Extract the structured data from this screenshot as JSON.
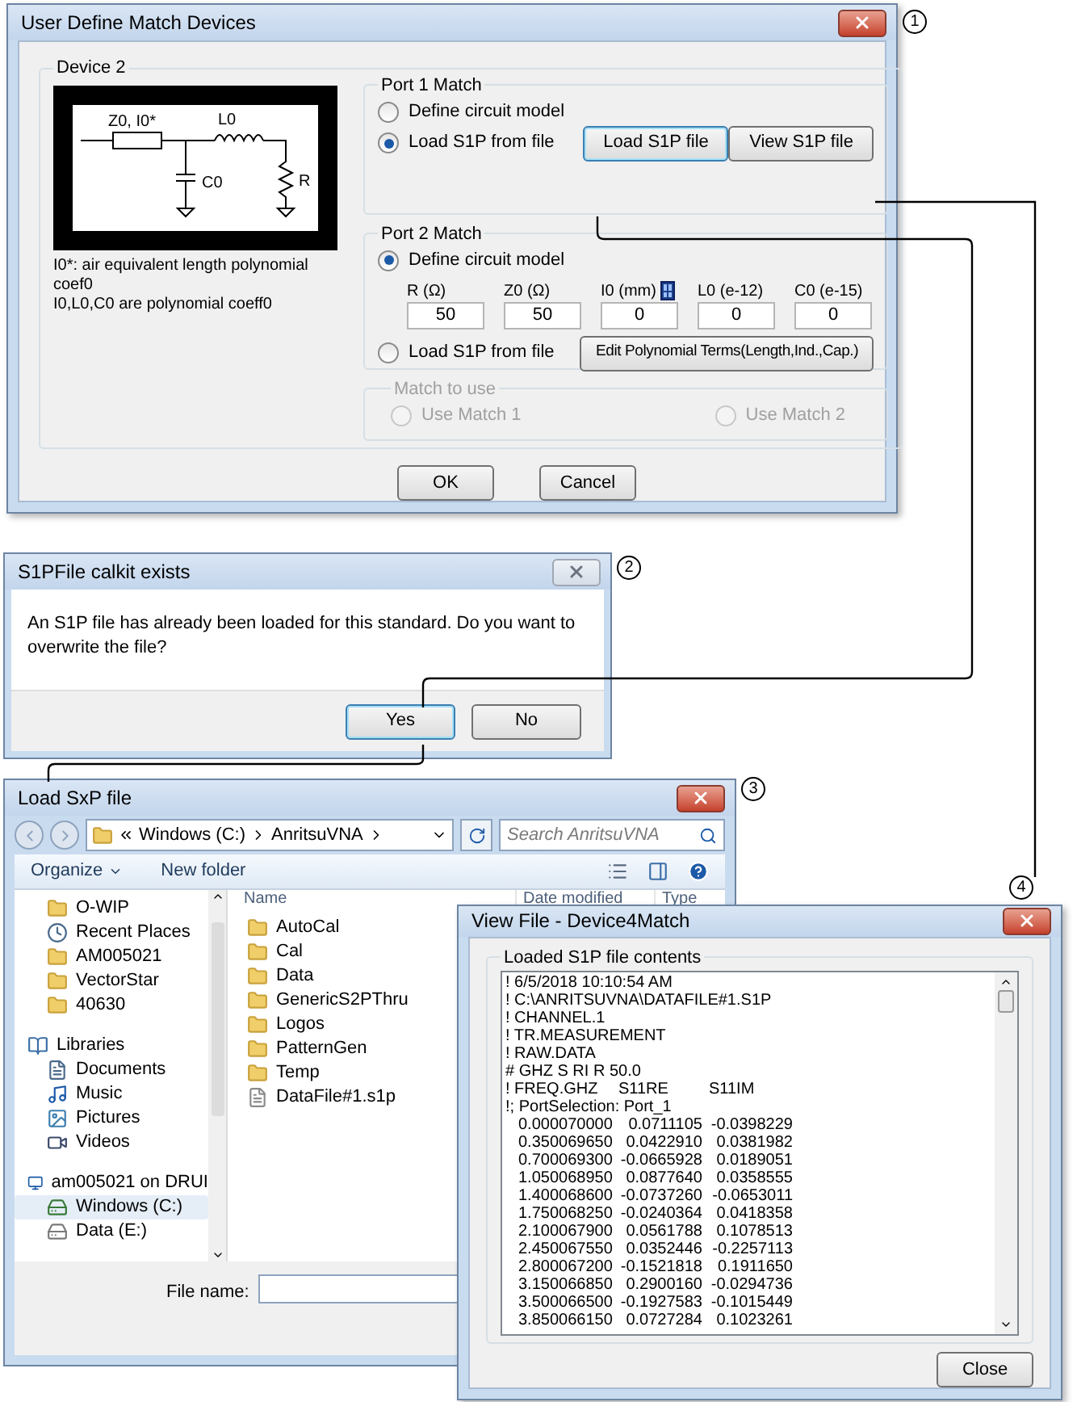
{
  "callouts": [
    "1",
    "2",
    "3",
    "4"
  ],
  "match_dialog": {
    "title": "User Define Match Devices",
    "group": "Device 2",
    "circuit_labels": [
      "Z0, I0*",
      "L0",
      "C0",
      "R"
    ],
    "notes": [
      "I0*: air equivalent length polynomial coef0",
      "I0,L0,C0 are polynomial coeff0"
    ],
    "port1": {
      "title": "Port 1 Match",
      "options": [
        {
          "label": "Define circuit model",
          "selected": false
        },
        {
          "label": "Load S1P from file",
          "selected": true
        }
      ],
      "load_button": "Load S1P file",
      "view_button": "View S1P file"
    },
    "port2": {
      "title": "Port 2 Match",
      "options": [
        {
          "label": "Define circuit model",
          "selected": true
        },
        {
          "label": "Load S1P from file",
          "selected": false
        }
      ],
      "fields": [
        {
          "label": "R (Ω)",
          "value": "50"
        },
        {
          "label": "Z0 (Ω)",
          "value": "50"
        },
        {
          "label": "I0 (mm)",
          "value": "0",
          "calculator": true
        },
        {
          "label": "L0 (e-12)",
          "value": "0"
        },
        {
          "label": "C0 (e-15)",
          "value": "0"
        }
      ],
      "edit_button": "Edit Polynomial Terms(Length,Ind.,Cap.)"
    },
    "match_to_use": {
      "title": "Match to use",
      "disabled": true,
      "options": [
        {
          "label": "Use Match 1",
          "selected": false
        },
        {
          "label": "Use Match 2",
          "selected": false
        }
      ]
    },
    "buttons": [
      "OK",
      "Cancel"
    ]
  },
  "overwrite_dialog": {
    "title": "S1PFile calkit exists",
    "message": "An S1P file has already been loaded for this standard. Do you want to overwrite the file?",
    "buttons": [
      {
        "label": "Yes",
        "default": true
      },
      {
        "label": "No",
        "default": false
      }
    ]
  },
  "file_dialog": {
    "title": "Load SxP file",
    "path": [
      "Windows (C:)",
      "AnritsuVNA"
    ],
    "search_placeholder": "Search AnritsuVNA",
    "toolbar": [
      "Organize",
      "New folder"
    ],
    "nav": [
      {
        "label": "O-WIP",
        "kind": "folder",
        "selected": false
      },
      {
        "label": "Recent Places",
        "kind": "recent",
        "selected": false
      },
      {
        "label": "AM005021",
        "kind": "folder",
        "selected": false
      },
      {
        "label": "VectorStar",
        "kind": "folder",
        "selected": false
      },
      {
        "label": "40630",
        "kind": "folder",
        "selected": false
      },
      {
        "label": "Libraries",
        "kind": "library",
        "selected": false,
        "children": [
          {
            "label": "Documents",
            "kind": "documents",
            "selected": false
          },
          {
            "label": "Music",
            "kind": "music",
            "selected": false
          },
          {
            "label": "Pictures",
            "kind": "pictures",
            "selected": false
          },
          {
            "label": "Videos",
            "kind": "videos",
            "selected": false
          }
        ]
      },
      {
        "label": "am005021 on DRUI",
        "kind": "computer",
        "selected": false,
        "children": [
          {
            "label": "Windows (C:)",
            "kind": "system_drive",
            "selected": true
          },
          {
            "label": "Data (E:)",
            "kind": "drive",
            "selected": false
          }
        ]
      }
    ],
    "columns": [
      "Name",
      "Date modified",
      "Type"
    ],
    "files": [
      {
        "name": "AutoCal",
        "kind": "folder"
      },
      {
        "name": "Cal",
        "kind": "folder"
      },
      {
        "name": "Data",
        "kind": "folder"
      },
      {
        "name": "GenericS2PThru",
        "kind": "folder"
      },
      {
        "name": "Logos",
        "kind": "folder"
      },
      {
        "name": "PatternGen",
        "kind": "folder"
      },
      {
        "name": "Temp",
        "kind": "folder"
      },
      {
        "name": "DataFile#1.s1p",
        "kind": "file"
      }
    ],
    "file_name_label": "File name:"
  },
  "view_file": {
    "title": "View File - Device4Match",
    "group": "Loaded S1P file contents",
    "header_lines": [
      "! 6/5/2018 10:10:54 AM",
      "! C:\\ANRITSUVNA\\DATAFILE#1.S1P",
      "! CHANNEL.1",
      "! TR.MEASUREMENT",
      "! RAW.DATA",
      "# GHZ S RI R 50.0"
    ],
    "column_line": [
      "! FREQ.GHZ",
      "S11RE",
      "S11IM"
    ],
    "port_line": "!; PortSelection: Port_1",
    "rows": [
      [
        "0.000070000",
        "0.0711105",
        "-0.0398229"
      ],
      [
        "0.350069650",
        "0.0422910",
        "0.0381982"
      ],
      [
        "0.700069300",
        "-0.0665928",
        "0.0189051"
      ],
      [
        "1.050068950",
        "0.0877640",
        "0.0358555"
      ],
      [
        "1.400068600",
        "-0.0737260",
        "-0.0653011"
      ],
      [
        "1.750068250",
        "-0.0240364",
        "0.0418358"
      ],
      [
        "2.100067900",
        "0.0561788",
        "0.1078513"
      ],
      [
        "2.450067550",
        "0.0352446",
        "-0.2257113"
      ],
      [
        "2.800067200",
        "-0.1521818",
        "0.1911650"
      ],
      [
        "3.150066850",
        "0.2900160",
        "-0.0294736"
      ],
      [
        "3.500066500",
        "-0.1927583",
        "-0.1015449"
      ],
      [
        "3.850066150",
        "0.0727284",
        "0.1023261"
      ]
    ],
    "button": "Close"
  }
}
